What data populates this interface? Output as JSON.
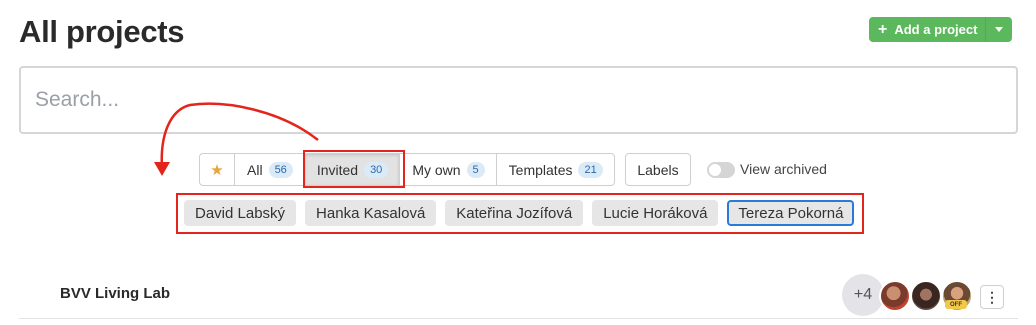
{
  "page": {
    "title": "All projects"
  },
  "header": {
    "add_project_label": "Add a project",
    "add_icon": "plus-icon",
    "dropdown_icon": "caret-down-icon"
  },
  "search": {
    "placeholder": "Search...",
    "value": ""
  },
  "filters": {
    "favorites_icon": "star-icon",
    "tabs": [
      {
        "label": "All",
        "count": "56",
        "active": false
      },
      {
        "label": "Invited",
        "count": "30",
        "active": true
      },
      {
        "label": "My own",
        "count": "5",
        "active": false
      },
      {
        "label": "Templates",
        "count": "21",
        "active": false
      }
    ],
    "labels_button": "Labels",
    "view_archived_label": "View archived",
    "view_archived_on": false
  },
  "people": [
    {
      "name": "David Labský",
      "selected": false
    },
    {
      "name": "Hanka Kasalová",
      "selected": false
    },
    {
      "name": "Kateřina Jozífová",
      "selected": false
    },
    {
      "name": "Lucie Horáková",
      "selected": false
    },
    {
      "name": "Tereza Pokorná",
      "selected": true
    }
  ],
  "projects": [
    {
      "title": "BVV Living Lab",
      "extra_members": "+4",
      "status_badge": "OFF",
      "menu_icon": "kebab-menu-icon"
    }
  ],
  "colors": {
    "accent_green": "#5cb85c",
    "highlight_red": "#e3251b",
    "selected_blue": "#2d79d6",
    "star": "#e8a33d"
  }
}
